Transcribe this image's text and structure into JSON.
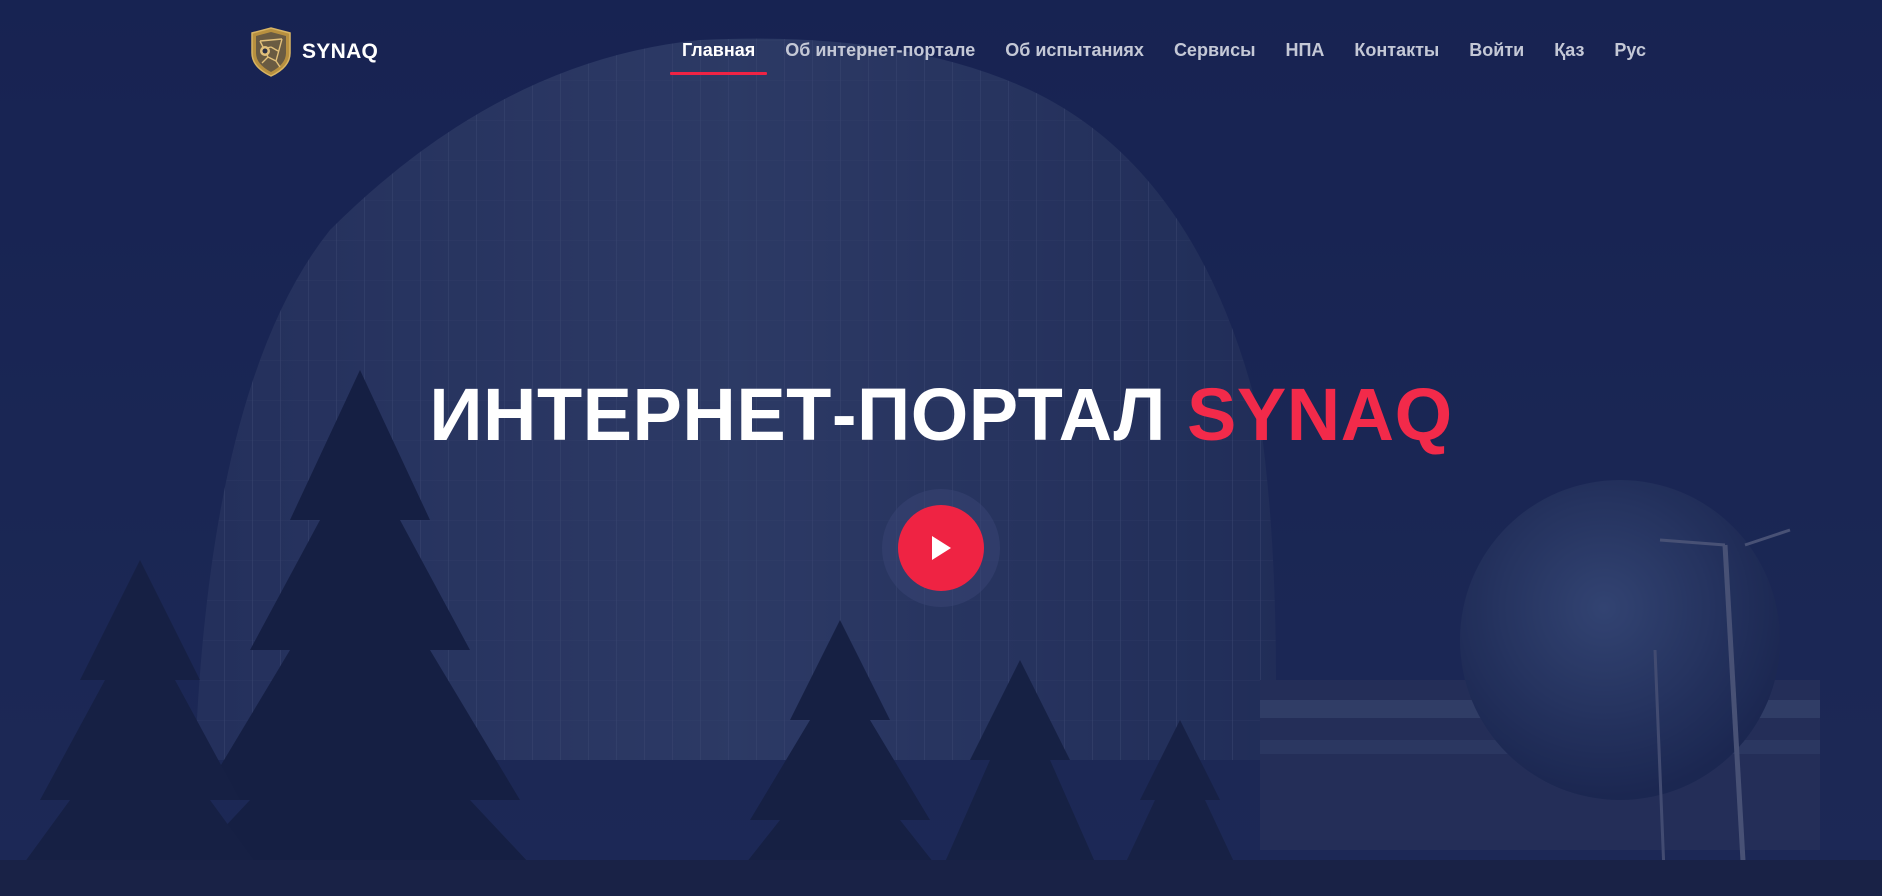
{
  "brand": {
    "name": "SYNAQ",
    "logo_icon": "shield-logo-icon"
  },
  "nav": {
    "items": [
      {
        "label": "Главная",
        "active": true
      },
      {
        "label": "Об интернет-портале",
        "active": false
      },
      {
        "label": "Об испытаниях",
        "active": false
      },
      {
        "label": "Сервисы",
        "active": false
      },
      {
        "label": "НПА",
        "active": false
      },
      {
        "label": "Контакты",
        "active": false
      },
      {
        "label": "Войти",
        "active": false
      },
      {
        "label": "Қаз",
        "active": false
      },
      {
        "label": "Рус",
        "active": false
      }
    ]
  },
  "hero": {
    "title_main": "ИНТЕРНЕТ-ПОРТАЛ ",
    "title_accent": "SYNAQ",
    "play_icon": "play-icon"
  },
  "colors": {
    "accent": "#ef2343",
    "overlay": "#121c46",
    "nav_text": "#c4c8d6",
    "logo_gold": "#c9a24a"
  }
}
